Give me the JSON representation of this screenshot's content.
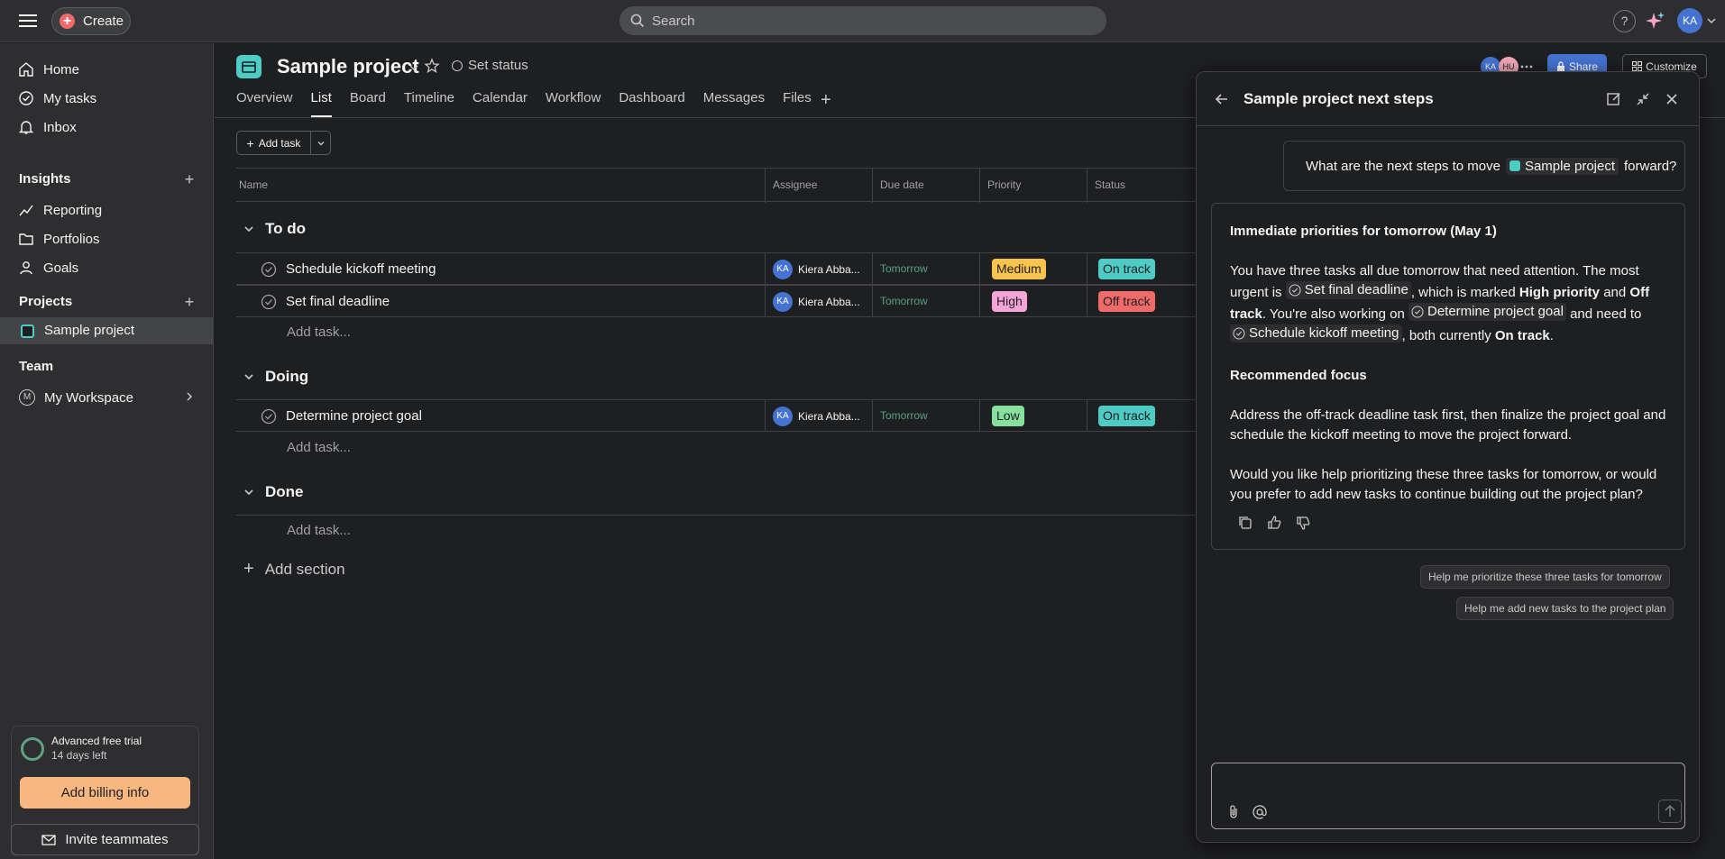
{
  "topbar": {
    "create_label": "Create",
    "search_placeholder": "Search",
    "help_label": "?",
    "user_initials": "KA"
  },
  "sidebar": {
    "nav": [
      {
        "label": "Home",
        "icon": "home-icon"
      },
      {
        "label": "My tasks",
        "icon": "check-circle-icon"
      },
      {
        "label": "Inbox",
        "icon": "bell-icon"
      }
    ],
    "insights_title": "Insights",
    "insights": [
      {
        "label": "Reporting",
        "icon": "chart-line-icon"
      },
      {
        "label": "Portfolios",
        "icon": "folder-icon"
      },
      {
        "label": "Goals",
        "icon": "person-icon"
      }
    ],
    "projects_title": "Projects",
    "project_item": "Sample project",
    "team_title": "Team",
    "workspace": {
      "initial": "M",
      "label": "My Workspace"
    },
    "trial": {
      "title": "Advanced free trial",
      "days_left": "14 days left",
      "billing_label": "Add billing info"
    },
    "invite_label": "Invite teammates"
  },
  "project": {
    "title": "Sample project",
    "set_status": "Set status",
    "tabs": [
      "Overview",
      "List",
      "Board",
      "Timeline",
      "Calendar",
      "Workflow",
      "Dashboard",
      "Messages",
      "Files"
    ],
    "active_tab": "List",
    "members": [
      {
        "initials": "KA",
        "color": "#4573d2"
      },
      {
        "initials": "HU",
        "color": "#f1a7b8"
      }
    ],
    "share_label": "Share",
    "customize_label": "Customize"
  },
  "toolbar": {
    "add_task_label": "Add task"
  },
  "table": {
    "columns": [
      "Name",
      "Assignee",
      "Due date",
      "Priority",
      "Status"
    ],
    "add_task_placeholder": "Add task...",
    "add_section_label": "Add section",
    "sections": [
      {
        "title": "To do",
        "tasks": [
          {
            "name": "Schedule kickoff meeting",
            "assignee": "Kiera Abba...",
            "assignee_initials": "KA",
            "due": "Tomorrow",
            "priority": "Medium",
            "priority_color": "#f8c34f",
            "status": "On track",
            "status_color": "#4ecbc4"
          },
          {
            "name": "Set final deadline",
            "assignee": "Kiera Abba...",
            "assignee_initials": "KA",
            "due": "Tomorrow",
            "priority": "High",
            "priority_color": "#f6a4d8",
            "status": "Off track",
            "status_color": "#f06a6a"
          }
        ]
      },
      {
        "title": "Doing",
        "tasks": [
          {
            "name": "Determine project goal",
            "assignee": "Kiera Abba...",
            "assignee_initials": "KA",
            "due": "Tomorrow",
            "priority": "Low",
            "priority_color": "#87e19e",
            "status": "On track",
            "status_color": "#4ecbc4"
          }
        ]
      },
      {
        "title": "Done",
        "tasks": []
      }
    ]
  },
  "ai_panel": {
    "title": "Sample project next steps",
    "user_question_prefix": "What are the next steps to move",
    "user_question_project": "Sample project",
    "user_question_suffix": "forward?",
    "response": {
      "heading1": "Immediate priorities for tomorrow (May 1)",
      "p1_a": "You have three tasks all due tomorrow that need attention. The most urgent is",
      "p1_chip1": "Set final deadline",
      "p1_b": ", which is marked",
      "p1_bold1": "High priority",
      "p1_c": "and",
      "p1_bold2": "Off track",
      "p1_d": ". You're also working on",
      "p1_chip2": "Determine project goal",
      "p1_e": "and need to",
      "p1_chip3": "Schedule kickoff meeting",
      "p1_f": ", both currently",
      "p1_bold3": "On track",
      "p1_g": ".",
      "heading2": "Recommended focus",
      "p2": "Address the off-track deadline task first, then finalize the project goal and schedule the kickoff meeting to move the project forward.",
      "p3": "Would you like help prioritizing these three tasks for tomorrow, or would you prefer to add new tasks to continue building out the project plan?"
    },
    "suggestions": [
      "Help me prioritize these three tasks for tomorrow",
      "Help me add new tasks to the project plan"
    ]
  }
}
